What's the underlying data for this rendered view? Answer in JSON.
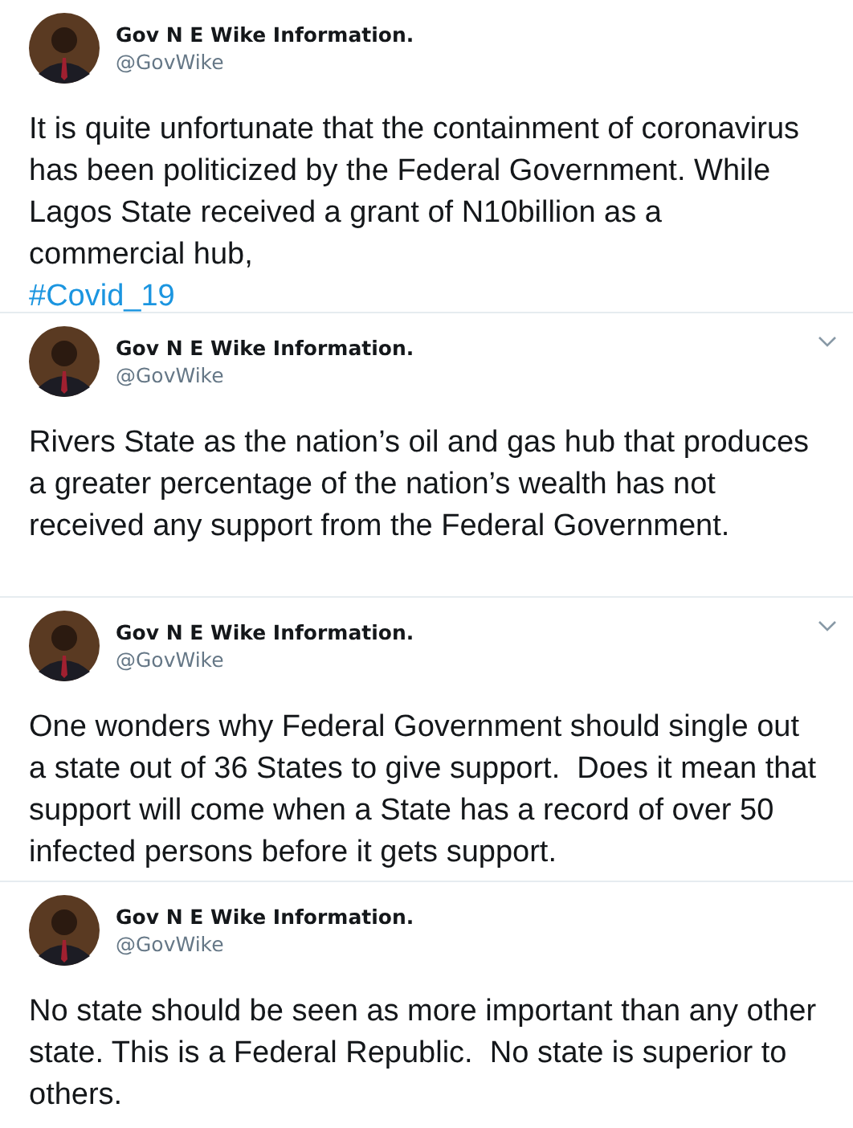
{
  "tweets": [
    {
      "author": "Gov N E Wike Information.",
      "handle": "@GovWike",
      "has_menu": false,
      "text": "It is quite unfortunate that the containment of coronavirus has been politicized by the Federal Government. While Lagos State received a grant of N10billion as a commercial hub,",
      "hashtag": "#Covid_19"
    },
    {
      "author": "Gov N E Wike Information.",
      "handle": "@GovWike",
      "has_menu": true,
      "text": "Rivers State as the nation’s oil and gas hub that produces a greater percentage of the nation’s wealth has not received any support from the Federal Government."
    },
    {
      "author": "Gov N E Wike Information.",
      "handle": "@GovWike",
      "has_menu": true,
      "text": "One wonders why Federal Government should single out a state out of 36 States to give support.  Does it mean that support will come when a State has a record of over 50 infected persons before it gets support."
    },
    {
      "author": "Gov N E Wike Information.",
      "handle": "@GovWike",
      "has_menu": false,
      "text": "No state should be seen as more important than any other state. This is a Federal Republic.  No state is superior to others."
    }
  ]
}
